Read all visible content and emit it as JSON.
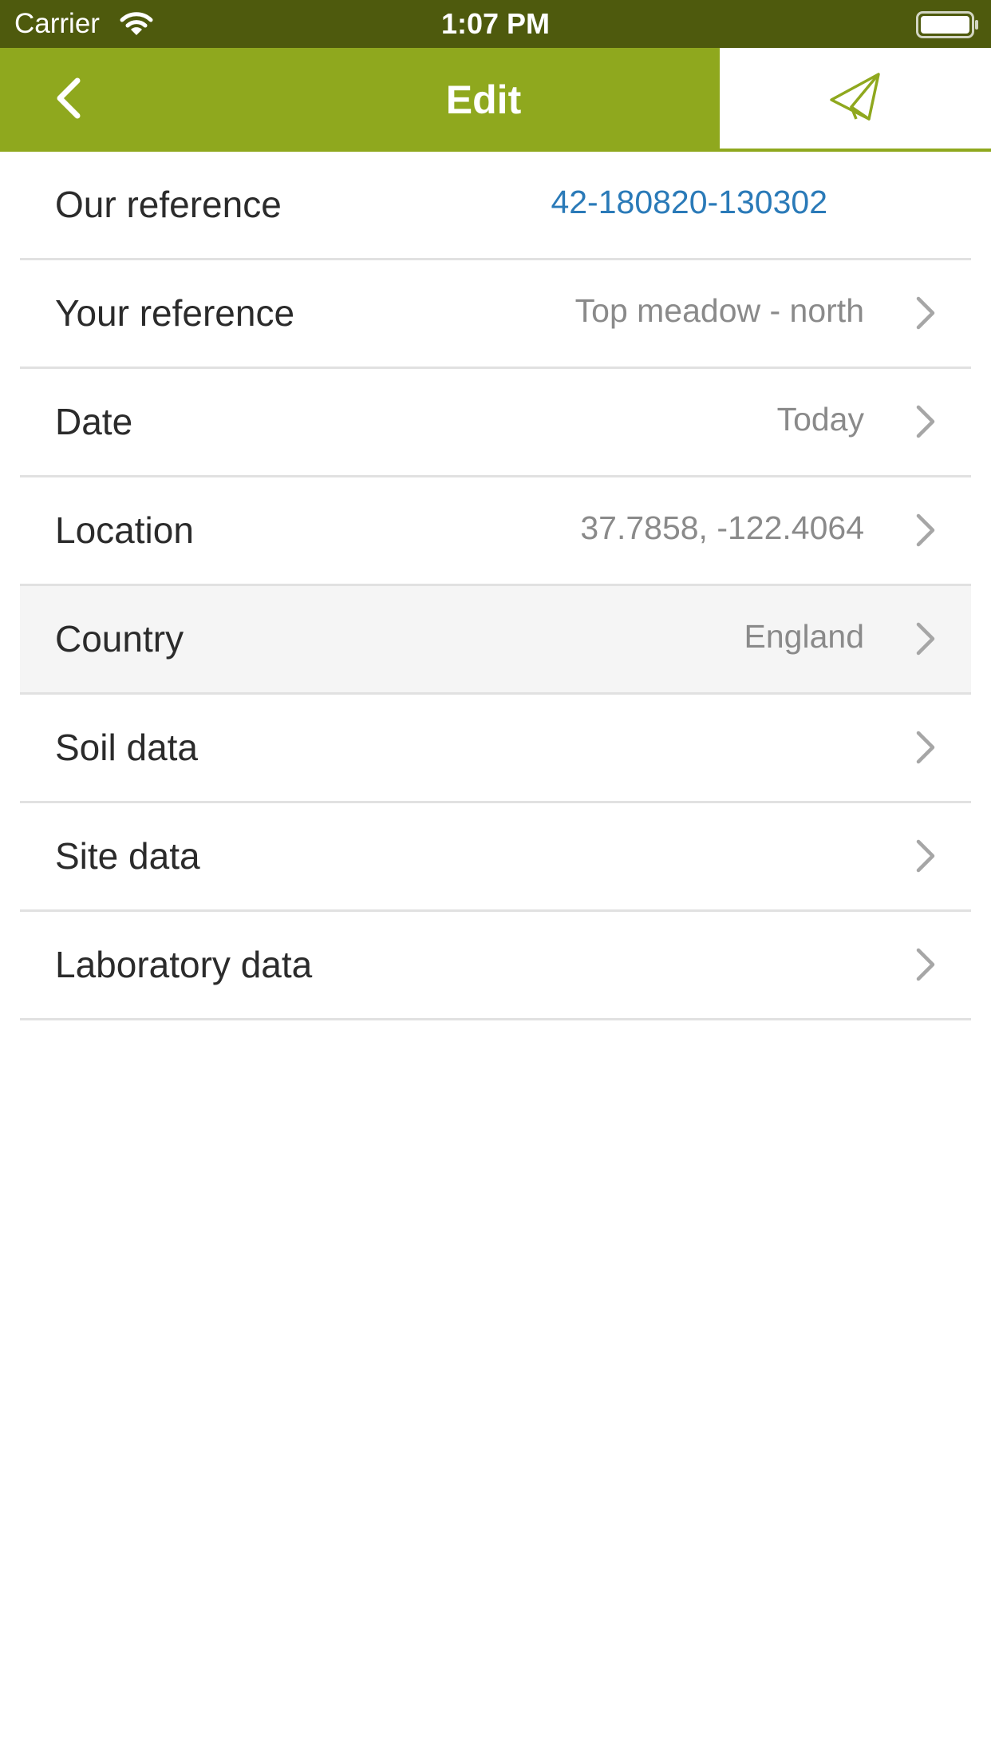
{
  "status_bar": {
    "carrier": "Carrier",
    "time": "1:07 PM",
    "wifi_icon": "wifi-icon",
    "battery_icon": "battery-icon"
  },
  "nav": {
    "title": "Edit",
    "back_icon": "chevron-left-icon",
    "send_icon": "paper-plane-icon"
  },
  "colors": {
    "status_bar": "#4e5a0d",
    "nav_bar": "#8fa81e",
    "accent": "#8fa81e",
    "link": "#2a7ab8",
    "value_text": "#8a8a8a",
    "label_text": "#2b2b2b",
    "divider": "#e1e1e1",
    "highlight_row": "#f5f5f5"
  },
  "rows": [
    {
      "label": "Our reference",
      "value": "42-180820-130302",
      "has_chevron": false
    },
    {
      "label": "Your reference",
      "value": "Top meadow - north",
      "has_chevron": true
    },
    {
      "label": "Date",
      "value": "Today",
      "has_chevron": true
    },
    {
      "label": "Location",
      "value": "37.7858, -122.4064",
      "has_chevron": true
    },
    {
      "label": "Country",
      "value": "England",
      "has_chevron": true,
      "highlighted": true
    },
    {
      "label": "Soil data",
      "value": "",
      "has_chevron": true
    },
    {
      "label": "Site data",
      "value": "",
      "has_chevron": true
    },
    {
      "label": "Laboratory data",
      "value": "",
      "has_chevron": true
    }
  ]
}
